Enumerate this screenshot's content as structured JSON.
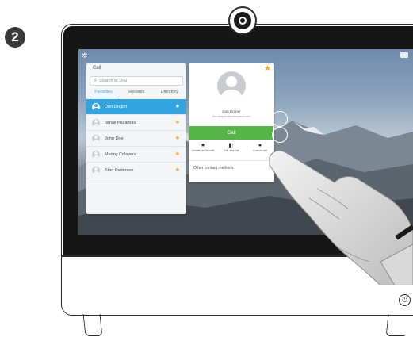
{
  "step": {
    "number": "2"
  },
  "call_panel": {
    "title": "Call",
    "search_placeholder": "Search or Dial",
    "tabs": [
      {
        "label": "Favorites",
        "active": true
      },
      {
        "label": "Recents",
        "active": false
      },
      {
        "label": "Directory",
        "active": false
      }
    ],
    "contacts": [
      {
        "name": "Don Draper",
        "selected": true
      },
      {
        "name": "Ismail Pazarbasi",
        "selected": false
      },
      {
        "name": "John Doe",
        "selected": false
      },
      {
        "name": "Manny Colavera",
        "selected": false
      },
      {
        "name": "Stan Pedersen",
        "selected": false
      }
    ]
  },
  "detail_panel": {
    "name": "Don Draper",
    "email": "don.draper@someplace.com",
    "call_label": "Call",
    "actions": [
      {
        "icon": "star-icon",
        "label": "Unmark as Favorite"
      },
      {
        "icon": "edit-call-icon",
        "label": "Edit and Call"
      },
      {
        "icon": "camera-icon",
        "label": "Custom call"
      }
    ],
    "other_methods_label": "Other contact methods"
  },
  "colors": {
    "accent_blue": "#31a3df",
    "call_green": "#55b547",
    "favorite_star": "#f5a623"
  }
}
